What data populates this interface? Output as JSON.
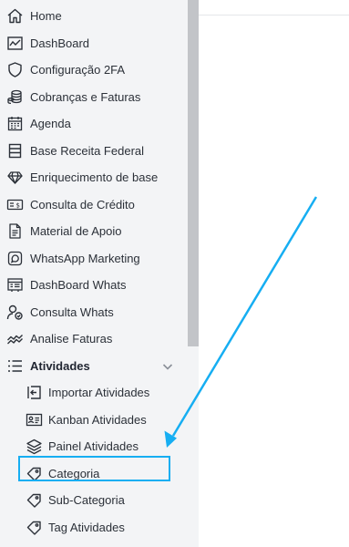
{
  "sidebar": {
    "items": [
      {
        "label": "Home",
        "icon": "home-icon"
      },
      {
        "label": "DashBoard",
        "icon": "chart-icon"
      },
      {
        "label": "Configuração 2FA",
        "icon": "shield-icon"
      },
      {
        "label": "Cobranças e Faturas",
        "icon": "coins-icon"
      },
      {
        "label": "Agenda",
        "icon": "calendar-icon"
      },
      {
        "label": "Base Receita Federal",
        "icon": "database-icon"
      },
      {
        "label": "Enriquecimento de base",
        "icon": "diamond-icon"
      },
      {
        "label": "Consulta de Crédito",
        "icon": "credit-check-icon"
      },
      {
        "label": "Material de Apoio",
        "icon": "document-icon"
      },
      {
        "label": "WhatsApp Marketing",
        "icon": "whatsapp-icon"
      },
      {
        "label": "DashBoard Whats",
        "icon": "whats-dashboard-icon"
      },
      {
        "label": "Consulta Whats",
        "icon": "user-check-icon"
      },
      {
        "label": "Analise Faturas",
        "icon": "trend-icon"
      }
    ],
    "group": {
      "label": "Atividades",
      "icon": "list-icon",
      "expanded": true,
      "children": [
        {
          "label": "Importar Atividades",
          "icon": "import-icon"
        },
        {
          "label": "Kanban Atividades",
          "icon": "id-card-icon"
        },
        {
          "label": "Painel Atividades",
          "icon": "layers-icon"
        },
        {
          "label": "Categoria",
          "icon": "tag-icon",
          "highlighted": true
        },
        {
          "label": "Sub-Categoria",
          "icon": "tag-icon"
        },
        {
          "label": "Tag Atividades",
          "icon": "tag-icon"
        }
      ]
    }
  },
  "colors": {
    "annotation": "#16aef2",
    "sidebar_bg": "#f3f4f6",
    "text": "#2b3038"
  }
}
